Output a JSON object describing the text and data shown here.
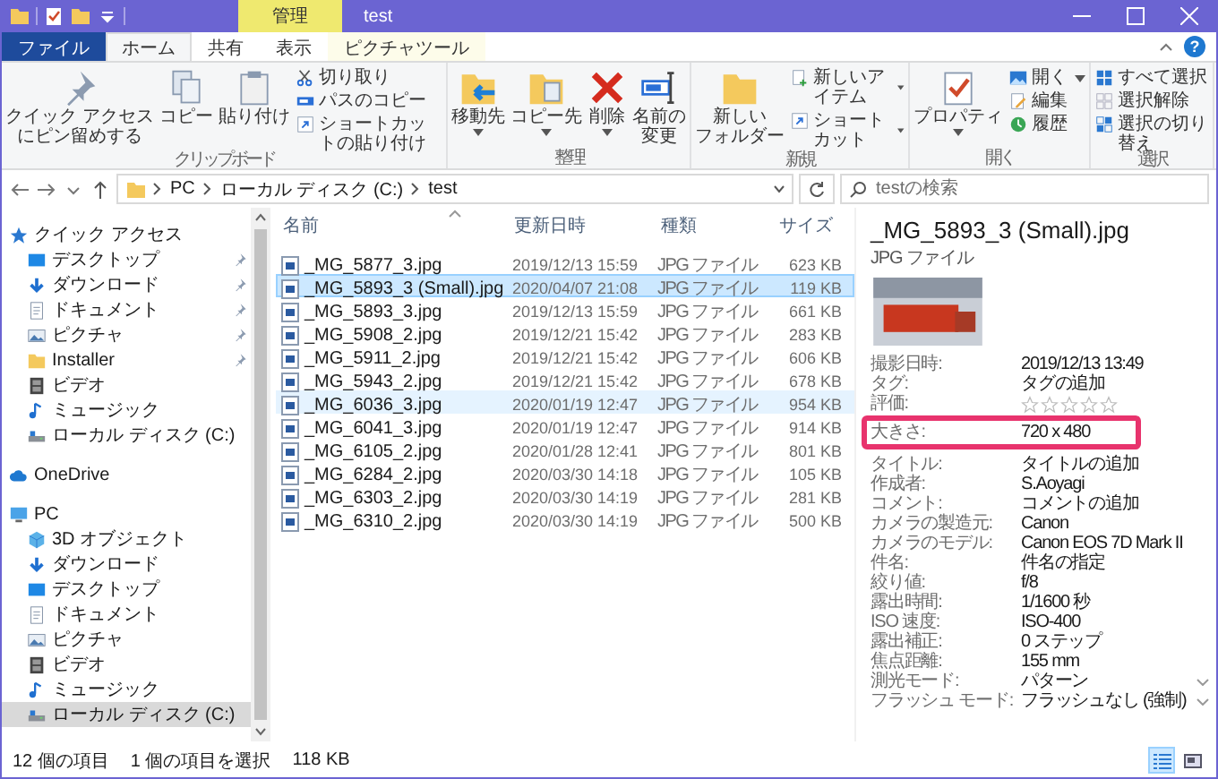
{
  "title_bar": {
    "context_header": "管理",
    "title": "test"
  },
  "ribbon_tabs": [
    {
      "label": "ファイル",
      "kind": "file",
      "selected": false
    },
    {
      "label": "ホーム",
      "kind": "normal",
      "selected": true
    },
    {
      "label": "共有",
      "kind": "normal",
      "selected": false
    },
    {
      "label": "表示",
      "kind": "normal",
      "selected": false
    },
    {
      "label": "ピクチャツール",
      "kind": "contextual",
      "selected": false
    }
  ],
  "ribbon_help": "?",
  "ribbon_groups": [
    {
      "label": "クリップボード",
      "items": [
        {
          "lines": [
            "クイック アクセス",
            "にピン留めする"
          ],
          "kind": "large",
          "dropdown": false
        },
        {
          "lines": [
            "コピー"
          ],
          "kind": "large",
          "dropdown": false
        },
        {
          "lines": [
            "貼り付け"
          ],
          "kind": "large",
          "dropdown": false
        },
        {
          "label": "切り取り",
          "kind": "small",
          "dropdown": false
        },
        {
          "label": "パスのコピー",
          "kind": "small",
          "dropdown": false
        },
        {
          "label": "ショートカットの貼り付け",
          "kind": "small",
          "dropdown": false
        }
      ]
    },
    {
      "label": "整理",
      "items": [
        {
          "lines": [
            "移動先"
          ],
          "kind": "large",
          "dropdown": true
        },
        {
          "lines": [
            "コピー先"
          ],
          "kind": "large",
          "dropdown": true
        },
        {
          "lines": [
            "削除"
          ],
          "kind": "large",
          "dropdown": true
        },
        {
          "lines": [
            "名前の",
            "変更"
          ],
          "kind": "large",
          "dropdown": false
        }
      ]
    },
    {
      "label": "新規",
      "items": [
        {
          "lines": [
            "新しい",
            "フォルダー"
          ],
          "kind": "large",
          "dropdown": false
        },
        {
          "label": "新しいアイテム",
          "kind": "small",
          "dropdown": true
        },
        {
          "label": "ショートカット",
          "kind": "small",
          "dropdown": true
        }
      ]
    },
    {
      "label": "開く",
      "items": [
        {
          "lines": [
            "プロパティ"
          ],
          "kind": "large",
          "dropdown": true
        },
        {
          "label": "開く",
          "kind": "small",
          "dropdown": true
        },
        {
          "label": "編集",
          "kind": "small",
          "dropdown": false
        },
        {
          "label": "履歴",
          "kind": "small",
          "dropdown": false
        }
      ]
    },
    {
      "label": "選択",
      "items": [
        {
          "label": "すべて選択",
          "kind": "small",
          "dropdown": false
        },
        {
          "label": "選択解除",
          "kind": "small",
          "dropdown": false
        },
        {
          "label": "選択の切り替え",
          "kind": "small",
          "dropdown": false
        }
      ]
    }
  ],
  "address": {
    "crumbs": [
      "PC",
      "ローカル ディスク (C:)",
      "test"
    ],
    "search": {
      "placeholder": "testの検索"
    }
  },
  "nav_tree": [
    {
      "label": "クイック アクセス",
      "kind": "quick",
      "selected": false,
      "children": [
        {
          "label": "デスクトップ",
          "kind": "desktop",
          "pinned": true,
          "selected": false
        },
        {
          "label": "ダウンロード",
          "kind": "download",
          "pinned": true,
          "selected": false
        },
        {
          "label": "ドキュメント",
          "kind": "document",
          "pinned": true,
          "selected": false
        },
        {
          "label": "ピクチャ",
          "kind": "pictures",
          "pinned": true,
          "selected": false
        },
        {
          "label": "Installer",
          "kind": "folder",
          "pinned": true,
          "selected": false
        },
        {
          "label": "ビデオ",
          "kind": "videos",
          "pinned": false,
          "selected": false
        },
        {
          "label": "ミュージック",
          "kind": "music",
          "pinned": false,
          "selected": false
        },
        {
          "label": "ローカル ディスク (C:)",
          "kind": "drive",
          "pinned": false,
          "selected": false
        }
      ]
    },
    {
      "label": "OneDrive",
      "kind": "cloud",
      "selected": false
    },
    {
      "label": "PC",
      "kind": "pc",
      "selected": false,
      "children": [
        {
          "label": "3D オブジェクト",
          "kind": "objects3d",
          "selected": false
        },
        {
          "label": "ダウンロード",
          "kind": "download",
          "selected": false
        },
        {
          "label": "デスクトップ",
          "kind": "desktop",
          "selected": false
        },
        {
          "label": "ドキュメント",
          "kind": "document",
          "selected": false
        },
        {
          "label": "ピクチャ",
          "kind": "pictures",
          "selected": false
        },
        {
          "label": "ビデオ",
          "kind": "videos",
          "selected": false
        },
        {
          "label": "ミュージック",
          "kind": "music",
          "selected": false
        },
        {
          "label": "ローカル ディスク (C:)",
          "kind": "drive",
          "selected": true
        }
      ]
    }
  ],
  "files": {
    "columns": [
      "名前",
      "更新日時",
      "種類",
      "サイズ"
    ],
    "rows": [
      {
        "name": "_MG_5877_3.jpg",
        "modified": "2019/12/13 15:59",
        "type": "JPG ファイル",
        "size": "623 KB",
        "selected": false,
        "hovered": false
      },
      {
        "name": "_MG_5893_3 (Small).jpg",
        "modified": "2020/04/07 21:08",
        "type": "JPG ファイル",
        "size": "119 KB",
        "selected": true,
        "hovered": false
      },
      {
        "name": "_MG_5893_3.jpg",
        "modified": "2019/12/13 15:59",
        "type": "JPG ファイル",
        "size": "661 KB",
        "selected": false,
        "hovered": false
      },
      {
        "name": "_MG_5908_2.jpg",
        "modified": "2019/12/21 15:42",
        "type": "JPG ファイル",
        "size": "283 KB",
        "selected": false,
        "hovered": false
      },
      {
        "name": "_MG_5911_2.jpg",
        "modified": "2019/12/21 15:42",
        "type": "JPG ファイル",
        "size": "606 KB",
        "selected": false,
        "hovered": false
      },
      {
        "name": "_MG_5943_2.jpg",
        "modified": "2019/12/21 15:42",
        "type": "JPG ファイル",
        "size": "678 KB",
        "selected": false,
        "hovered": false
      },
      {
        "name": "_MG_6036_3.jpg",
        "modified": "2020/01/19 12:47",
        "type": "JPG ファイル",
        "size": "954 KB",
        "selected": false,
        "hovered": true
      },
      {
        "name": "_MG_6041_3.jpg",
        "modified": "2020/01/19 12:47",
        "type": "JPG ファイル",
        "size": "914 KB",
        "selected": false,
        "hovered": false
      },
      {
        "name": "_MG_6105_2.jpg",
        "modified": "2020/01/28 12:41",
        "type": "JPG ファイル",
        "size": "801 KB",
        "selected": false,
        "hovered": false
      },
      {
        "name": "_MG_6284_2.jpg",
        "modified": "2020/03/30 14:18",
        "type": "JPG ファイル",
        "size": "105 KB",
        "selected": false,
        "hovered": false
      },
      {
        "name": "_MG_6303_2.jpg",
        "modified": "2020/03/30 14:19",
        "type": "JPG ファイル",
        "size": "281 KB",
        "selected": false,
        "hovered": false
      },
      {
        "name": "_MG_6310_2.jpg",
        "modified": "2020/03/30 14:19",
        "type": "JPG ファイル",
        "size": "500 KB",
        "selected": false,
        "hovered": false
      }
    ]
  },
  "details": {
    "title": "_MG_5893_3 (Small).jpg",
    "type": "JPG ファイル",
    "properties": [
      {
        "label": "撮影日時:",
        "value": "2019/12/13 13:49",
        "kind": "text",
        "highlighted": false
      },
      {
        "label": "タグ:",
        "value": "タグの追加",
        "kind": "text",
        "highlighted": false
      },
      {
        "label": "評価:",
        "kind": "stars",
        "stars": 0,
        "highlighted": false
      },
      {
        "label": "大きさ:",
        "value": "720 x 480",
        "kind": "text",
        "highlighted": true
      },
      {
        "label": "タイトル:",
        "value": "タイトルの追加",
        "kind": "text",
        "highlighted": false
      },
      {
        "label": "作成者:",
        "value": "S.Aoyagi",
        "kind": "text",
        "highlighted": false
      },
      {
        "label": "コメント:",
        "value": "コメントの追加",
        "kind": "text",
        "highlighted": false
      },
      {
        "label": "カメラの製造元:",
        "value": "Canon",
        "kind": "text",
        "highlighted": false
      },
      {
        "label": "カメラのモデル:",
        "value": "Canon EOS 7D Mark II",
        "kind": "text",
        "highlighted": false
      },
      {
        "label": "件名:",
        "value": "件名の指定",
        "kind": "text",
        "highlighted": false
      },
      {
        "label": "絞り値:",
        "value": "f/8",
        "kind": "text",
        "highlighted": false
      },
      {
        "label": "露出時間:",
        "value": "1/1600 秒",
        "kind": "text",
        "highlighted": false
      },
      {
        "label": "ISO 速度:",
        "value": "ISO-400",
        "kind": "text",
        "highlighted": false
      },
      {
        "label": "露出補正:",
        "value": "0 ステップ",
        "kind": "text",
        "highlighted": false
      },
      {
        "label": "焦点距離:",
        "value": "155 mm",
        "kind": "text",
        "highlighted": false
      },
      {
        "label": "測光モード:",
        "value": "パターン",
        "kind": "dropdown",
        "highlighted": false
      },
      {
        "label": "フラッシュ モード:",
        "value": "フラッシュなし (強制)",
        "kind": "dropdown",
        "highlighted": false
      }
    ]
  },
  "status_bar": {
    "item_count": "12 個の項目",
    "selection": "1 個の項目を選択",
    "selection_size": "118 KB",
    "views": [
      {
        "kind": "details",
        "selected": true
      },
      {
        "kind": "large_icons",
        "selected": false
      }
    ]
  }
}
